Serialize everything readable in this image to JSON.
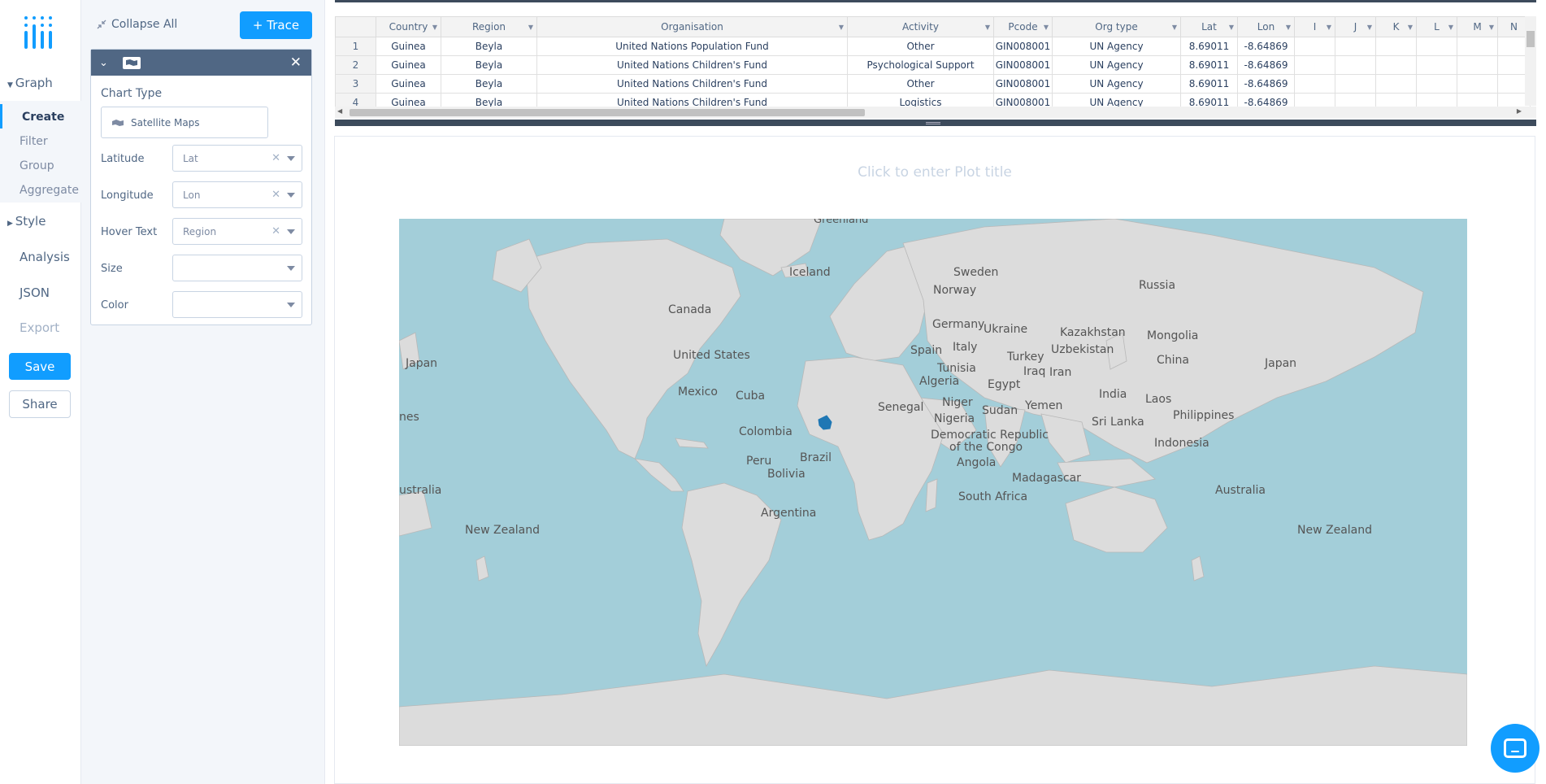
{
  "nav": {
    "graph": "Graph",
    "graph_items": [
      "Create",
      "Filter",
      "Group",
      "Aggregate"
    ],
    "style": "Style",
    "analysis": "Analysis",
    "json": "JSON",
    "export": "Export",
    "save": "Save",
    "share": "Share"
  },
  "panel": {
    "collapse_all": "Collapse All",
    "add_trace": "+ Trace",
    "chart_type_label": "Chart Type",
    "chart_type_value": "Satellite Maps",
    "fields": [
      {
        "label": "Latitude",
        "value": "Lat",
        "clearable": true
      },
      {
        "label": "Longitude",
        "value": "Lon",
        "clearable": true
      },
      {
        "label": "Hover Text",
        "value": "Region",
        "clearable": true
      },
      {
        "label": "Size",
        "value": "",
        "clearable": false
      },
      {
        "label": "Color",
        "value": "",
        "clearable": false
      }
    ]
  },
  "table": {
    "columns": [
      "Country",
      "Region",
      "Organisation",
      "Activity",
      "Pcode",
      "Org type",
      "Lat",
      "Lon",
      "I",
      "J",
      "K",
      "L",
      "M",
      "N"
    ],
    "rows": [
      [
        "1",
        "Guinea",
        "Beyla",
        "United Nations Population Fund",
        "Other",
        "GIN008001",
        "UN Agency",
        "8.69011",
        "-8.64869"
      ],
      [
        "2",
        "Guinea",
        "Beyla",
        "United Nations Children's Fund",
        "Psychological Support",
        "GIN008001",
        "UN Agency",
        "8.69011",
        "-8.64869"
      ],
      [
        "3",
        "Guinea",
        "Beyla",
        "United Nations Children's Fund",
        "Other",
        "GIN008001",
        "UN Agency",
        "8.69011",
        "-8.64869"
      ],
      [
        "4",
        "Guinea",
        "Beyla",
        "United Nations Children's Fund",
        "Logistics",
        "GIN008001",
        "UN Agency",
        "8.69011",
        "-8.64869"
      ]
    ]
  },
  "plot": {
    "title_placeholder": "Click to enter Plot title",
    "map_labels": [
      "Greenland",
      "Iceland",
      "Sweden",
      "Norway",
      "Russia",
      "Canada",
      "Germany",
      "Ukraine",
      "Kazakhstan",
      "Mongolia",
      "United States",
      "Spain",
      "Italy",
      "Turkey",
      "Uzbekistan",
      "Japan",
      "Japan",
      "Tunisia",
      "Iraq",
      "Iran",
      "China",
      "Mexico",
      "Cuba",
      "Algeria",
      "Egypt",
      "India",
      "Laos",
      "Niger",
      "Sudan",
      "Yemen",
      "Senegal",
      "Nigeria",
      "Sri Lanka",
      "Philippines",
      "Colombia",
      "Democratic Republic",
      "of the Congo",
      "Indonesia",
      "Peru",
      "Brazil",
      "Bolivia",
      "Angola",
      "Madagascar",
      "Australia",
      "South Africa",
      "Argentina",
      "New Zealand",
      "New Zealand",
      "ustralia",
      "nes"
    ],
    "highlight_region": "Guinea"
  },
  "colors": {
    "accent": "#119dff",
    "ocean": "#a3ced9",
    "land": "#dcdcdc",
    "highlight": "#1f77b4"
  }
}
